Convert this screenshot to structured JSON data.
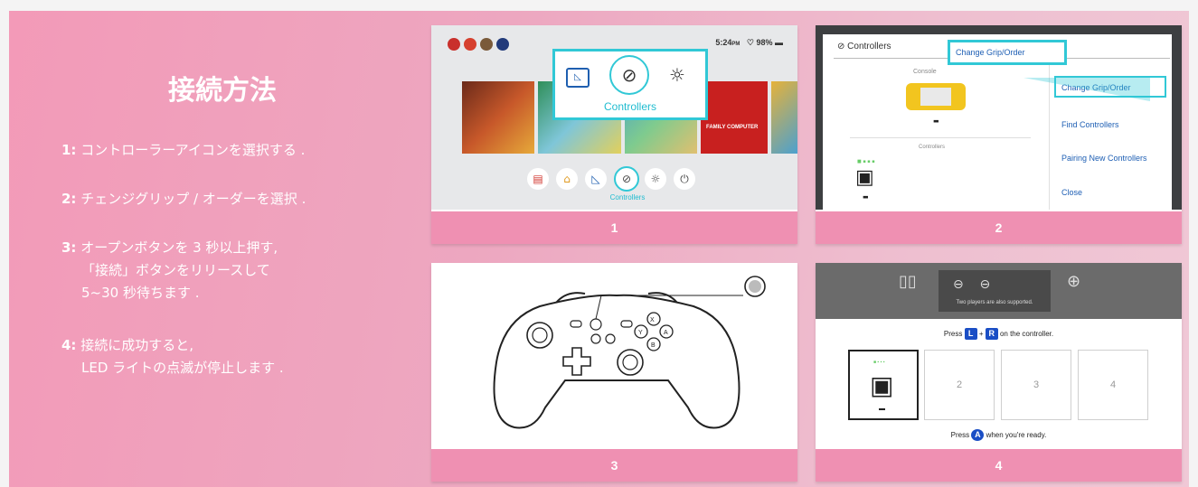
{
  "title": "接続方法",
  "steps": [
    {
      "num": "1:",
      "lines": [
        "コントローラーアイコンを選択する ."
      ]
    },
    {
      "num": "2:",
      "lines": [
        "チェンジグリップ / オーダーを選択 ."
      ]
    },
    {
      "num": "3:",
      "lines": [
        "オープンボタンを 3 秒以上押す,",
        "「接続」ボタンをリリースして",
        "5~30 秒待ちます ."
      ]
    },
    {
      "num": "4:",
      "lines": [
        "接続に成功すると,",
        "LED ライトの点滅が停止します ."
      ]
    }
  ],
  "cards": {
    "c1": {
      "footer": "1",
      "time": "5:24",
      "ampm": "PM",
      "battery": "98%",
      "popup_label": "Controllers",
      "dock_label": "Controllers",
      "tile_text": "FAMILY COMPUTER"
    },
    "c2": {
      "footer": "2",
      "header": "Controllers",
      "tooltip": "Change Grip/Order",
      "console_label": "Console",
      "controllers_label": "Controllers",
      "menu": [
        "Change Grip/Order",
        "Find Controllers",
        "Pairing New Controllers",
        "Close"
      ]
    },
    "c3": {
      "footer": "3"
    },
    "c4": {
      "footer": "4",
      "players_note": "Two players are also supported.",
      "press_prefix": "Press",
      "key_l": "L",
      "plus": "+",
      "key_r": "R",
      "press_suffix": "on the controller.",
      "slots": [
        "2",
        "3",
        "4"
      ],
      "ready_prefix": "Press",
      "key_a": "A",
      "ready_suffix": "when you're ready."
    }
  },
  "colors": {
    "footer": "#ef90b2",
    "accent": "#31c8d6",
    "menu_blue": "#1e5fb4"
  }
}
